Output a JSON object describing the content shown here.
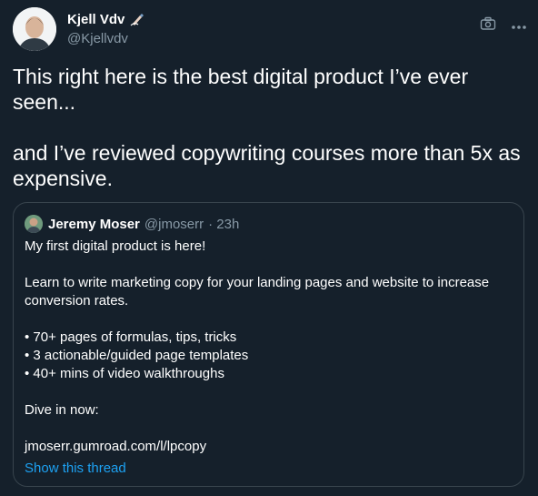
{
  "author": {
    "name": "Kjell Vdv",
    "handle": "@Kjellvdv",
    "badge_icon": "writing-hand-icon"
  },
  "actions": {
    "camera_icon": "camera-icon",
    "more_icon": "more-dots-icon"
  },
  "tweet": {
    "text": "This right here is the best digital product I’ve ever seen...\n\nand I’ve reviewed copywriting courses more than 5x as expensive."
  },
  "quoted": {
    "name": "Jeremy Moser",
    "handle": "@jmoserr",
    "time": "· 23h",
    "lines": [
      "My first digital product is here!",
      "",
      "Learn to write marketing copy for your landing pages and website to increase conversion rates.",
      "",
      "• 70+ pages of formulas, tips, tricks",
      "• 3 actionable/guided page templates",
      "• 40+ mins of video walkthroughs",
      "",
      "Dive in now:",
      "",
      "jmoserr.gumroad.com/l/lpcopy"
    ],
    "show_thread": "Show this thread"
  },
  "colors": {
    "background": "#15202b",
    "border": "#38444d",
    "secondary_text": "#8899a6",
    "link": "#1da1f2"
  }
}
